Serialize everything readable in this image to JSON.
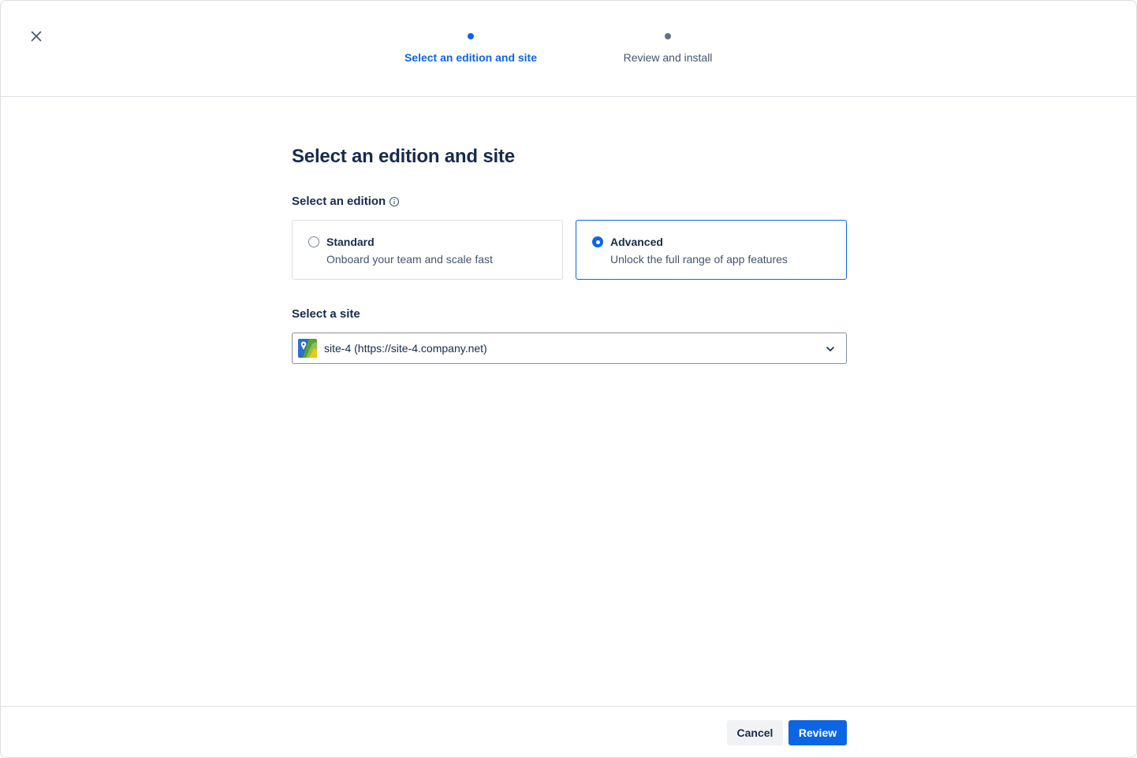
{
  "header": {
    "close_icon": "close-icon",
    "steps": [
      {
        "label": "Select an edition and site",
        "state": "active"
      },
      {
        "label": "Review and install",
        "state": "upcoming"
      }
    ]
  },
  "main": {
    "title": "Select an edition and site",
    "edition_section": {
      "label": "Select an edition",
      "info_icon": "info-icon",
      "options": [
        {
          "name": "Standard",
          "description": "Onboard your team and scale fast",
          "selected": false
        },
        {
          "name": "Advanced",
          "description": "Unlock the full range of app features",
          "selected": true
        }
      ]
    },
    "site_section": {
      "label": "Select a site",
      "selected_value": "site-4 (https://site-4.company.net)",
      "icon": "chevron-down-icon"
    }
  },
  "footer": {
    "cancel_label": "Cancel",
    "review_label": "Review"
  },
  "colors": {
    "accent": "#0c66e4",
    "text_primary": "#172b4d",
    "text_subtle": "#44546f",
    "border": "#dcdfe4"
  }
}
